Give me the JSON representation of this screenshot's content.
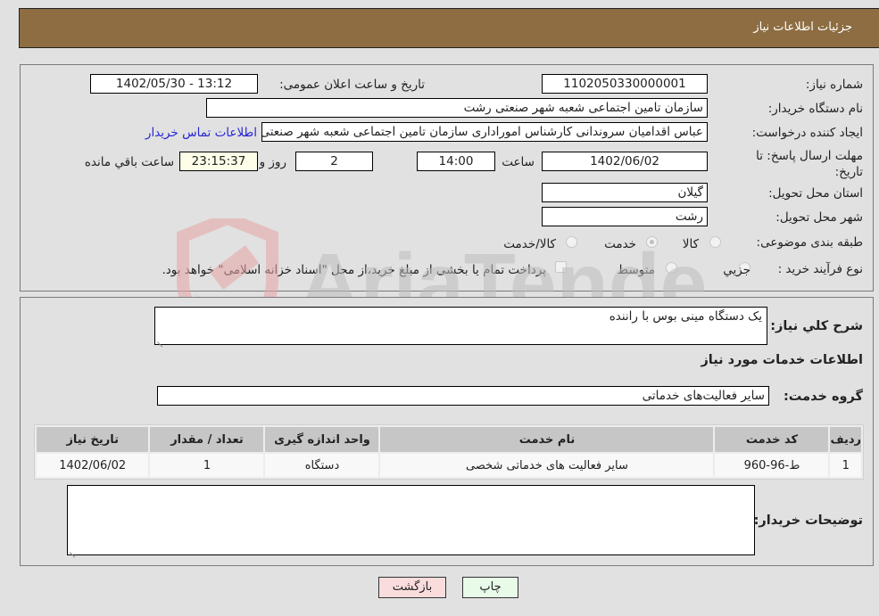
{
  "header": {
    "title": "جزئیات اطلاعات نیاز"
  },
  "fields": {
    "need_number_label": "شماره نیاز:",
    "need_number": "1102050330000001",
    "announce_label": "تاریخ و ساعت اعلان عمومی:",
    "announce_value": "1402/05/30 - 13:12",
    "buyer_org_label": "نام دستگاه خریدار:",
    "buyer_org": "سازمان تامین اجتماعی شعبه شهر صنعتی رشت",
    "creator_label": "ایجاد کننده درخواست:",
    "creator": "عباس اقدامیان سروندانی کارشناس امورادارى سازمان تامین اجتماعی شعبه شهر صنعتی رشت",
    "contact_link": "اطلاعات تماس خریدار",
    "deadline_label": "مهلت ارسال پاسخ: تا تاریخ:",
    "deadline_date": "1402/06/02",
    "time_label": "ساعت",
    "deadline_time": "14:00",
    "days_value": "2",
    "days_label": "روز و",
    "remaining_time": "23:15:37",
    "remaining_label": "ساعت باقي مانده",
    "province_label": "استان محل تحویل:",
    "province": "گیلان",
    "city_label": "شهر محل تحویل:",
    "city": "رشت",
    "category_label": "طبقه بندی موضوعی:",
    "category_options": [
      {
        "label": "کالا",
        "checked": false
      },
      {
        "label": "خدمت",
        "checked": true
      },
      {
        "label": "کالا/خدمت",
        "checked": false
      }
    ],
    "process_label": "نوع فرآیند خرید :",
    "process_options": [
      {
        "label": "جزیي",
        "checked": false
      },
      {
        "label": "متوسط",
        "checked": false
      }
    ],
    "treasury_note": "پرداخت تمام یا بخشی از مبلغ خرید،از محل \"اسناد خزانه اسلامی\" خواهد بود."
  },
  "description": {
    "label": "شرح کلي نیاز:",
    "value": "یک دستگاه مینی بوس با راننده"
  },
  "services": {
    "section_title": "اطلاعات خدمات مورد نیاز",
    "group_label": "گروه خدمت:",
    "group_value": "سایر فعالیت‌های خدماتی",
    "columns": [
      "ردیف",
      "کد خدمت",
      "نام خدمت",
      "واحد اندازه گیری",
      "تعداد / مقدار",
      "تاریخ نیاز"
    ],
    "rows": [
      [
        "1",
        "ط-96-960",
        "سایر فعالیت های خدماتی شخصی",
        "دستگاه",
        "1",
        "1402/06/02"
      ]
    ]
  },
  "buyer_notes": {
    "label": "توضیحات خریدار:",
    "value": ""
  },
  "buttons": {
    "print": "چاپ",
    "back": "بازگشت"
  },
  "watermark": {
    "text": "AriaTender.neT"
  }
}
